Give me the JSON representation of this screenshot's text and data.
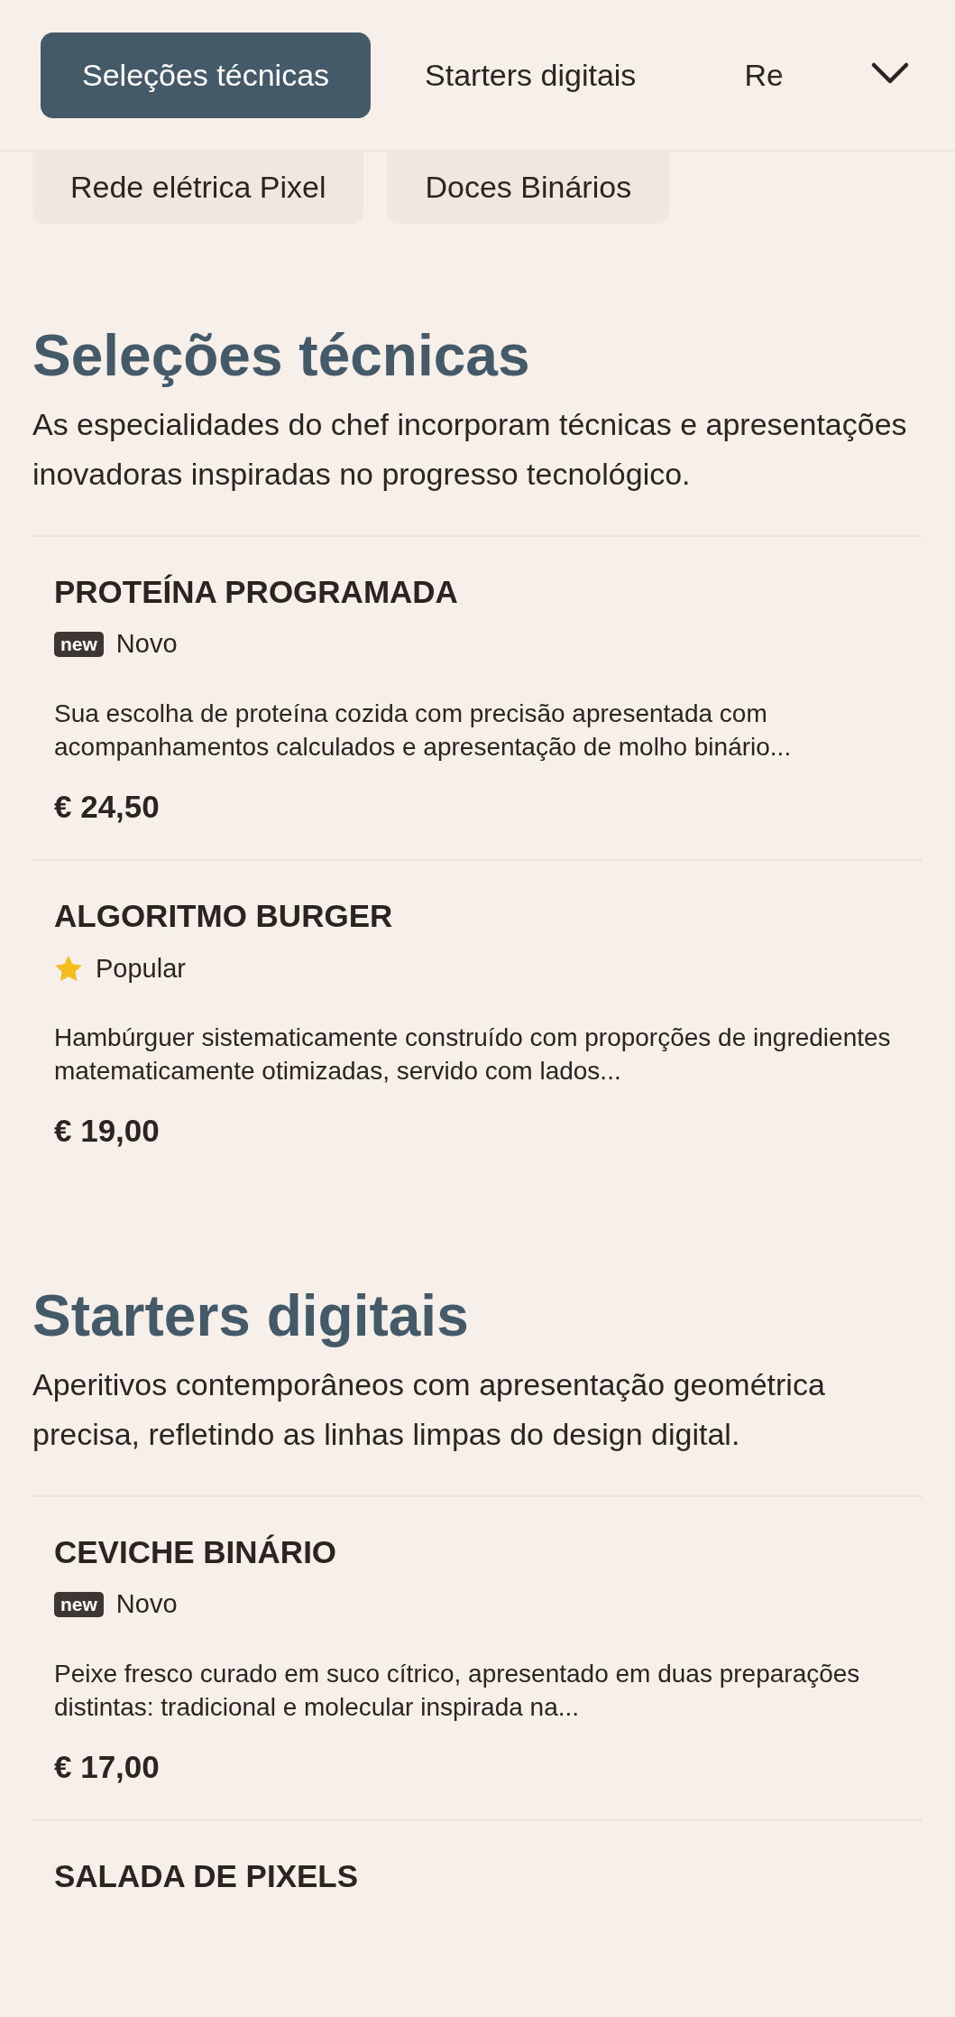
{
  "tabs": [
    {
      "label": "Seleções técnicas",
      "selected": true
    },
    {
      "label": "Starters digitais",
      "selected": false
    },
    {
      "label": "Re",
      "selected": false
    }
  ],
  "subcategories": [
    {
      "label": "Rede elétrica Pixel"
    },
    {
      "label": "Doces Binários"
    }
  ],
  "sections": [
    {
      "title": "Seleções técnicas",
      "description": "As especialidades do chef incorporam técnicas e apresentações inovadoras inspiradas no progresso tecnológico.",
      "items": [
        {
          "name": "PROTEÍNA PROGRAMADA",
          "tag": {
            "kind": "new",
            "badge": "new",
            "label": "Novo"
          },
          "description": "Sua escolha de proteína cozida com precisão apresentada com acompanhamentos calculados e apresentação de molho binário...",
          "price": "€ 24,50"
        },
        {
          "name": "ALGORITMO BURGER",
          "tag": {
            "kind": "popular",
            "label": "Popular"
          },
          "description": "Hambúrguer sistematicamente construído com proporções de ingredientes matematicamente otimizadas, servido com lados...",
          "price": "€ 19,00"
        }
      ]
    },
    {
      "title": "Starters digitais",
      "description": "Aperitivos contemporâneos com apresentação geométrica precisa, refletindo as linhas limpas do design digital.",
      "items": [
        {
          "name": "CEVICHE BINÁRIO",
          "tag": {
            "kind": "new",
            "badge": "new",
            "label": "Novo"
          },
          "description": "Peixe fresco curado em suco cítrico, apresentado em duas preparações distintas: tradicional e molecular inspirada na...",
          "price": "€ 17,00"
        },
        {
          "name": "SALADA DE PIXELS"
        }
      ]
    }
  ]
}
